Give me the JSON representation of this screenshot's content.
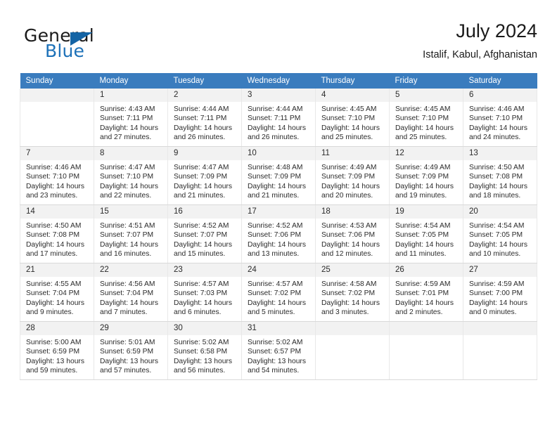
{
  "brand": {
    "word_one": "General",
    "word_two": "Blue",
    "logo_icon": "triangle-flag-icon"
  },
  "header": {
    "title": "July 2024",
    "subtitle": "Istalif, Kabul, Afghanistan"
  },
  "colors": {
    "header_row": "#3a7cbe",
    "brand_blue": "#1d71b8",
    "daynum_bg": "#f2f2f2",
    "grid_line": "#e8e8e8"
  },
  "calendar": {
    "weekday_headers": [
      "Sunday",
      "Monday",
      "Tuesday",
      "Wednesday",
      "Thursday",
      "Friday",
      "Saturday"
    ],
    "labels": {
      "sunrise": "Sunrise:",
      "sunset": "Sunset:",
      "daylight": "Daylight:"
    },
    "weeks": [
      [
        {
          "day": "",
          "blank": true,
          "sunrise": "",
          "sunset": "",
          "daylight_1": "",
          "daylight_2": ""
        },
        {
          "day": "1",
          "sunrise": "Sunrise: 4:43 AM",
          "sunset": "Sunset: 7:11 PM",
          "daylight_1": "Daylight: 14 hours",
          "daylight_2": "and 27 minutes."
        },
        {
          "day": "2",
          "sunrise": "Sunrise: 4:44 AM",
          "sunset": "Sunset: 7:11 PM",
          "daylight_1": "Daylight: 14 hours",
          "daylight_2": "and 26 minutes."
        },
        {
          "day": "3",
          "sunrise": "Sunrise: 4:44 AM",
          "sunset": "Sunset: 7:11 PM",
          "daylight_1": "Daylight: 14 hours",
          "daylight_2": "and 26 minutes."
        },
        {
          "day": "4",
          "sunrise": "Sunrise: 4:45 AM",
          "sunset": "Sunset: 7:10 PM",
          "daylight_1": "Daylight: 14 hours",
          "daylight_2": "and 25 minutes."
        },
        {
          "day": "5",
          "sunrise": "Sunrise: 4:45 AM",
          "sunset": "Sunset: 7:10 PM",
          "daylight_1": "Daylight: 14 hours",
          "daylight_2": "and 25 minutes."
        },
        {
          "day": "6",
          "sunrise": "Sunrise: 4:46 AM",
          "sunset": "Sunset: 7:10 PM",
          "daylight_1": "Daylight: 14 hours",
          "daylight_2": "and 24 minutes."
        }
      ],
      [
        {
          "day": "7",
          "sunrise": "Sunrise: 4:46 AM",
          "sunset": "Sunset: 7:10 PM",
          "daylight_1": "Daylight: 14 hours",
          "daylight_2": "and 23 minutes."
        },
        {
          "day": "8",
          "sunrise": "Sunrise: 4:47 AM",
          "sunset": "Sunset: 7:10 PM",
          "daylight_1": "Daylight: 14 hours",
          "daylight_2": "and 22 minutes."
        },
        {
          "day": "9",
          "sunrise": "Sunrise: 4:47 AM",
          "sunset": "Sunset: 7:09 PM",
          "daylight_1": "Daylight: 14 hours",
          "daylight_2": "and 21 minutes."
        },
        {
          "day": "10",
          "sunrise": "Sunrise: 4:48 AM",
          "sunset": "Sunset: 7:09 PM",
          "daylight_1": "Daylight: 14 hours",
          "daylight_2": "and 21 minutes."
        },
        {
          "day": "11",
          "sunrise": "Sunrise: 4:49 AM",
          "sunset": "Sunset: 7:09 PM",
          "daylight_1": "Daylight: 14 hours",
          "daylight_2": "and 20 minutes."
        },
        {
          "day": "12",
          "sunrise": "Sunrise: 4:49 AM",
          "sunset": "Sunset: 7:09 PM",
          "daylight_1": "Daylight: 14 hours",
          "daylight_2": "and 19 minutes."
        },
        {
          "day": "13",
          "sunrise": "Sunrise: 4:50 AM",
          "sunset": "Sunset: 7:08 PM",
          "daylight_1": "Daylight: 14 hours",
          "daylight_2": "and 18 minutes."
        }
      ],
      [
        {
          "day": "14",
          "sunrise": "Sunrise: 4:50 AM",
          "sunset": "Sunset: 7:08 PM",
          "daylight_1": "Daylight: 14 hours",
          "daylight_2": "and 17 minutes."
        },
        {
          "day": "15",
          "sunrise": "Sunrise: 4:51 AM",
          "sunset": "Sunset: 7:07 PM",
          "daylight_1": "Daylight: 14 hours",
          "daylight_2": "and 16 minutes."
        },
        {
          "day": "16",
          "sunrise": "Sunrise: 4:52 AM",
          "sunset": "Sunset: 7:07 PM",
          "daylight_1": "Daylight: 14 hours",
          "daylight_2": "and 15 minutes."
        },
        {
          "day": "17",
          "sunrise": "Sunrise: 4:52 AM",
          "sunset": "Sunset: 7:06 PM",
          "daylight_1": "Daylight: 14 hours",
          "daylight_2": "and 13 minutes."
        },
        {
          "day": "18",
          "sunrise": "Sunrise: 4:53 AM",
          "sunset": "Sunset: 7:06 PM",
          "daylight_1": "Daylight: 14 hours",
          "daylight_2": "and 12 minutes."
        },
        {
          "day": "19",
          "sunrise": "Sunrise: 4:54 AM",
          "sunset": "Sunset: 7:05 PM",
          "daylight_1": "Daylight: 14 hours",
          "daylight_2": "and 11 minutes."
        },
        {
          "day": "20",
          "sunrise": "Sunrise: 4:54 AM",
          "sunset": "Sunset: 7:05 PM",
          "daylight_1": "Daylight: 14 hours",
          "daylight_2": "and 10 minutes."
        }
      ],
      [
        {
          "day": "21",
          "sunrise": "Sunrise: 4:55 AM",
          "sunset": "Sunset: 7:04 PM",
          "daylight_1": "Daylight: 14 hours",
          "daylight_2": "and 9 minutes."
        },
        {
          "day": "22",
          "sunrise": "Sunrise: 4:56 AM",
          "sunset": "Sunset: 7:04 PM",
          "daylight_1": "Daylight: 14 hours",
          "daylight_2": "and 7 minutes."
        },
        {
          "day": "23",
          "sunrise": "Sunrise: 4:57 AM",
          "sunset": "Sunset: 7:03 PM",
          "daylight_1": "Daylight: 14 hours",
          "daylight_2": "and 6 minutes."
        },
        {
          "day": "24",
          "sunrise": "Sunrise: 4:57 AM",
          "sunset": "Sunset: 7:02 PM",
          "daylight_1": "Daylight: 14 hours",
          "daylight_2": "and 5 minutes."
        },
        {
          "day": "25",
          "sunrise": "Sunrise: 4:58 AM",
          "sunset": "Sunset: 7:02 PM",
          "daylight_1": "Daylight: 14 hours",
          "daylight_2": "and 3 minutes."
        },
        {
          "day": "26",
          "sunrise": "Sunrise: 4:59 AM",
          "sunset": "Sunset: 7:01 PM",
          "daylight_1": "Daylight: 14 hours",
          "daylight_2": "and 2 minutes."
        },
        {
          "day": "27",
          "sunrise": "Sunrise: 4:59 AM",
          "sunset": "Sunset: 7:00 PM",
          "daylight_1": "Daylight: 14 hours",
          "daylight_2": "and 0 minutes."
        }
      ],
      [
        {
          "day": "28",
          "sunrise": "Sunrise: 5:00 AM",
          "sunset": "Sunset: 6:59 PM",
          "daylight_1": "Daylight: 13 hours",
          "daylight_2": "and 59 minutes."
        },
        {
          "day": "29",
          "sunrise": "Sunrise: 5:01 AM",
          "sunset": "Sunset: 6:59 PM",
          "daylight_1": "Daylight: 13 hours",
          "daylight_2": "and 57 minutes."
        },
        {
          "day": "30",
          "sunrise": "Sunrise: 5:02 AM",
          "sunset": "Sunset: 6:58 PM",
          "daylight_1": "Daylight: 13 hours",
          "daylight_2": "and 56 minutes."
        },
        {
          "day": "31",
          "sunrise": "Sunrise: 5:02 AM",
          "sunset": "Sunset: 6:57 PM",
          "daylight_1": "Daylight: 13 hours",
          "daylight_2": "and 54 minutes."
        },
        {
          "day": "",
          "blank": true,
          "sunrise": "",
          "sunset": "",
          "daylight_1": "",
          "daylight_2": ""
        },
        {
          "day": "",
          "blank": true,
          "sunrise": "",
          "sunset": "",
          "daylight_1": "",
          "daylight_2": ""
        },
        {
          "day": "",
          "blank": true,
          "sunrise": "",
          "sunset": "",
          "daylight_1": "",
          "daylight_2": ""
        }
      ]
    ]
  }
}
